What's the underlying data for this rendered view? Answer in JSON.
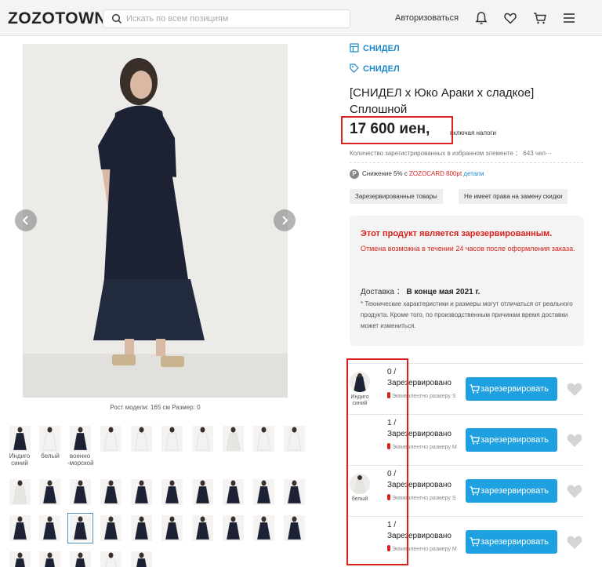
{
  "header": {
    "logo": "ZOZOTOWN",
    "search_placeholder": "Искать по всем позициям",
    "login_label": "Авторизоваться"
  },
  "gallery": {
    "caption": "Рост модели: 165 см Размер: 0",
    "thumb_labels": [
      "Индиго синий",
      "белый",
      "военно -морской"
    ]
  },
  "product": {
    "shop": "СНИДЕЛ",
    "brand": "СНИДЕЛ",
    "title": "[СНИДЕЛ х Юко Араки х сладкое] Сплошной",
    "price": "17 600 иен,",
    "tax_note": "включая налоги",
    "favorite_count": "Количество зарегистрированных в избранном элементе ： 643 чел···",
    "discount_prefix": "Снижение 5% с",
    "discount_card": "ZOZOCARD 800pt",
    "discount_link": "детали",
    "tags": [
      "Зарезервированные товары",
      "Не имеет права на замену скидки"
    ]
  },
  "notice": {
    "title": "Этот продукт является зарезервированным.",
    "subtitle": "Отмена возможна в течении 24 часов после оформления заказа.",
    "delivery_label": "Доставка ：",
    "delivery_value": "В конце мая 2021 г.",
    "note": "* Технические характеристики и размеры могут отличаться от реального продукта. Кроме того, по производственным причинам время доставки может измениться."
  },
  "sizes": [
    {
      "color": "Индиго синий",
      "stock": "0 / Зарезервировано",
      "size_note": "Эквивалентно размеру S",
      "button": "зарезервировать"
    },
    {
      "color": "",
      "stock": "1 / Зарезервировано",
      "size_note": "Эквивалентно размеру M",
      "button": "зарезервировать"
    },
    {
      "color": "белый",
      "stock": "0 / Зарезервировано",
      "size_note": "Эквивалентно размеру S",
      "button": "зарезервировать"
    },
    {
      "color": "",
      "stock": "1 / Зарезервировано",
      "size_note": "Эквивалентно размеру M",
      "button": "зарезервировать"
    }
  ],
  "colors": {
    "accent_blue": "#1fa0e0",
    "link_blue": "#1e88c8",
    "highlight_red": "#d9201c",
    "dress_navy": "#1c2233"
  },
  "icons": [
    "search-icon",
    "bell-icon",
    "heart-icon",
    "cart-icon",
    "menu-icon",
    "shop-icon",
    "tag-icon",
    "chevron-left-icon",
    "chevron-right-icon",
    "cart-icon",
    "heart-icon"
  ]
}
